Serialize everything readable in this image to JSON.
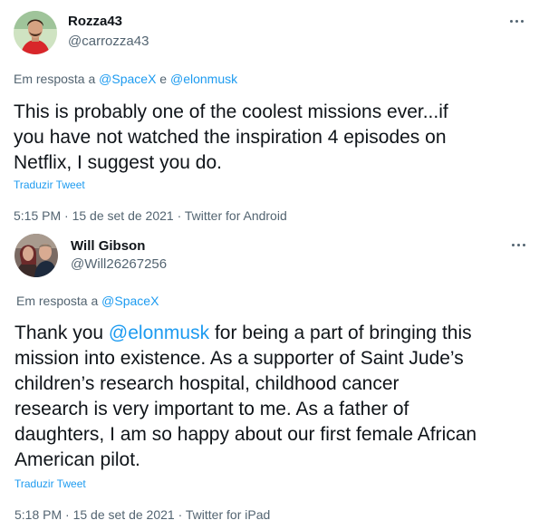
{
  "tweets": [
    {
      "display_name": "Rozza43",
      "handle": "@carrozza43",
      "avatar_icon": "profile-photo-icon",
      "more_icon": "more-options-icon",
      "reply_prefix": "Em resposta a ",
      "reply_to": [
        "@SpaceX",
        "@elonmusk"
      ],
      "reply_conjunction": " e ",
      "body_lines": [
        "This is probably one of the coolest missions ever...if",
        "you have not watched the inspiration 4 episodes on",
        "Netflix, I suggest you do."
      ],
      "translate_label": "Traduzir Tweet",
      "time": "5:15 PM",
      "date": "15 de set de 2021",
      "source": "Twitter for Android"
    },
    {
      "display_name": "Will Gibson",
      "handle": "@Will26267256",
      "avatar_icon": "profile-photo-icon",
      "more_icon": "more-options-icon",
      "reply_prefix": "Em resposta a ",
      "reply_to": [
        "@SpaceX"
      ],
      "body_mention": "@elonmusk",
      "body_lines": [
        "Thank you ",
        " for being a part of bringing this",
        "mission into existence. As a supporter of Saint Jude’s",
        "children’s research hospital, childhood cancer",
        "research is very important to me. As a father of",
        "daughters, I am so happy about our first female African",
        "American pilot."
      ],
      "translate_label": "Traduzir Tweet",
      "time": "5:18 PM",
      "date": "15 de set de 2021",
      "source": "Twitter for iPad"
    }
  ],
  "separator": " · ",
  "colors": {
    "text": "#0f1419",
    "secondary": "#536471",
    "link": "#1d9bf0",
    "divider": "#eff3f4"
  }
}
